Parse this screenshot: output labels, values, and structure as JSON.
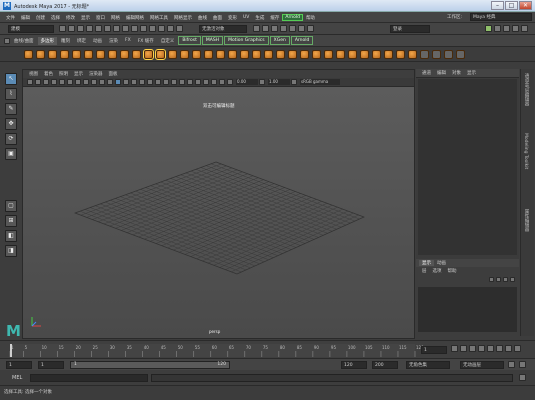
{
  "title": {
    "logo": "M",
    "text": "Autodesk Maya 2017 - 无标题*",
    "controls": [
      "–",
      "□",
      "✕"
    ]
  },
  "menubar": {
    "items": [
      "文件",
      "编辑",
      "创建",
      "选择",
      "修改",
      "显示",
      "窗口",
      "网格",
      "编辑网格",
      "网格工具",
      "网格显示",
      "曲线",
      "曲面",
      "变形",
      "UV",
      "生成",
      "缓存",
      "Arnold",
      "帮助"
    ],
    "highlighted": "Arnold",
    "workspace_label": "工作区:",
    "workspace_value": "Maya 经典"
  },
  "statusline": {
    "mode": "建模",
    "field": "无激活对象",
    "render_label": "登录"
  },
  "shelf": {
    "tabs": [
      "曲线/曲面",
      "多边形",
      "雕刻",
      "绑定",
      "动画",
      "渲染",
      "FX",
      "FX 缓存",
      "自定义",
      "Bifrost",
      "MASH",
      "Motion Graphics",
      "XGen",
      "Arnold"
    ],
    "selected_tab": "多边形",
    "boxed_tabs": [
      "Bifrost",
      "MASH",
      "Motion Graphics",
      "XGen",
      "Arnold"
    ]
  },
  "viewport": {
    "menu": [
      "视图",
      "着色",
      "照明",
      "显示",
      "渲染器",
      "面板"
    ],
    "camera_label": "persp",
    "overlay_text": "双击可编辑标题",
    "fields": {
      "left": "0.00",
      "right": "1.00",
      "color": "sRGB gamma"
    }
  },
  "channel_box": {
    "menu": [
      "通道",
      "编辑",
      "对象",
      "显示"
    ],
    "layers_tabs": [
      "显示",
      "动画"
    ],
    "layers_menu": [
      "层",
      "选项",
      "帮助"
    ]
  },
  "side_tabs": [
    "通道盒/层编辑器",
    "Modeling Toolkit",
    "属性编辑器"
  ],
  "timeline": {
    "ticks": [
      1,
      5,
      10,
      15,
      20,
      25,
      30,
      35,
      40,
      45,
      50,
      55,
      60,
      65,
      70,
      75,
      80,
      85,
      90,
      95,
      100,
      105,
      110,
      115,
      120
    ],
    "current_frame": "1"
  },
  "range": {
    "start": "1",
    "inner_start": "1",
    "range_value": "1",
    "range_end": "120",
    "end": "120",
    "max": "200",
    "char_set": "无角色集",
    "anim_layer": "无动画层"
  },
  "cmd": {
    "label": "MEL"
  },
  "help": {
    "text": "选择工具: 选择一个对象"
  },
  "colors": {
    "accent": "#5b8bb5",
    "shelf_icon": "#e38a2c",
    "arnold_highlight": "#2e6e3a"
  }
}
